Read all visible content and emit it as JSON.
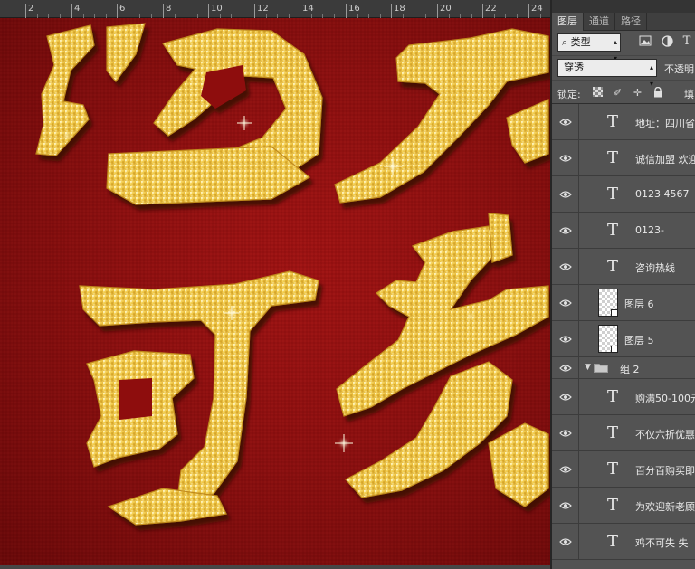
{
  "ruler": {
    "labels": [
      "2",
      "4",
      "6",
      "8",
      "10",
      "12",
      "14",
      "16",
      "18",
      "20",
      "22",
      "24"
    ]
  },
  "panel": {
    "tabs": [
      "图层",
      "通道",
      "路径"
    ],
    "active_tab": "图层",
    "filter": {
      "kind_label": "类型",
      "icons": [
        "image-filter-icon",
        "adjustment-filter-icon",
        "type-filter-icon"
      ],
      "type_filter_glyph": "T"
    },
    "blend": {
      "mode": "穿透",
      "opacity_label": "不透明"
    },
    "lock": {
      "label": "锁定:",
      "fill_label": "填"
    },
    "layers": [
      {
        "kind": "text",
        "name": "地址：四川省"
      },
      {
        "kind": "text",
        "name": "诚信加盟 欢迎"
      },
      {
        "kind": "text",
        "name": "0123 4567"
      },
      {
        "kind": "text",
        "name": "0123-"
      },
      {
        "kind": "text",
        "name": "咨询热线"
      },
      {
        "kind": "raster",
        "name": "图层 6"
      },
      {
        "kind": "raster",
        "name": "图层 5"
      },
      {
        "kind": "group",
        "name": "组 2"
      },
      {
        "kind": "text",
        "name": "购满50-100元"
      },
      {
        "kind": "text",
        "name": "不仅六折优惠"
      },
      {
        "kind": "text",
        "name": "百分百购买即"
      },
      {
        "kind": "text",
        "name": "为欢迎新老顾"
      },
      {
        "kind": "text",
        "name": "鸡不可失 失"
      }
    ],
    "type_glyph": "T"
  },
  "colors": {
    "canvas_red": "#8e0e0e",
    "gold": "#f2c94c",
    "panel_bg": "#535353"
  }
}
